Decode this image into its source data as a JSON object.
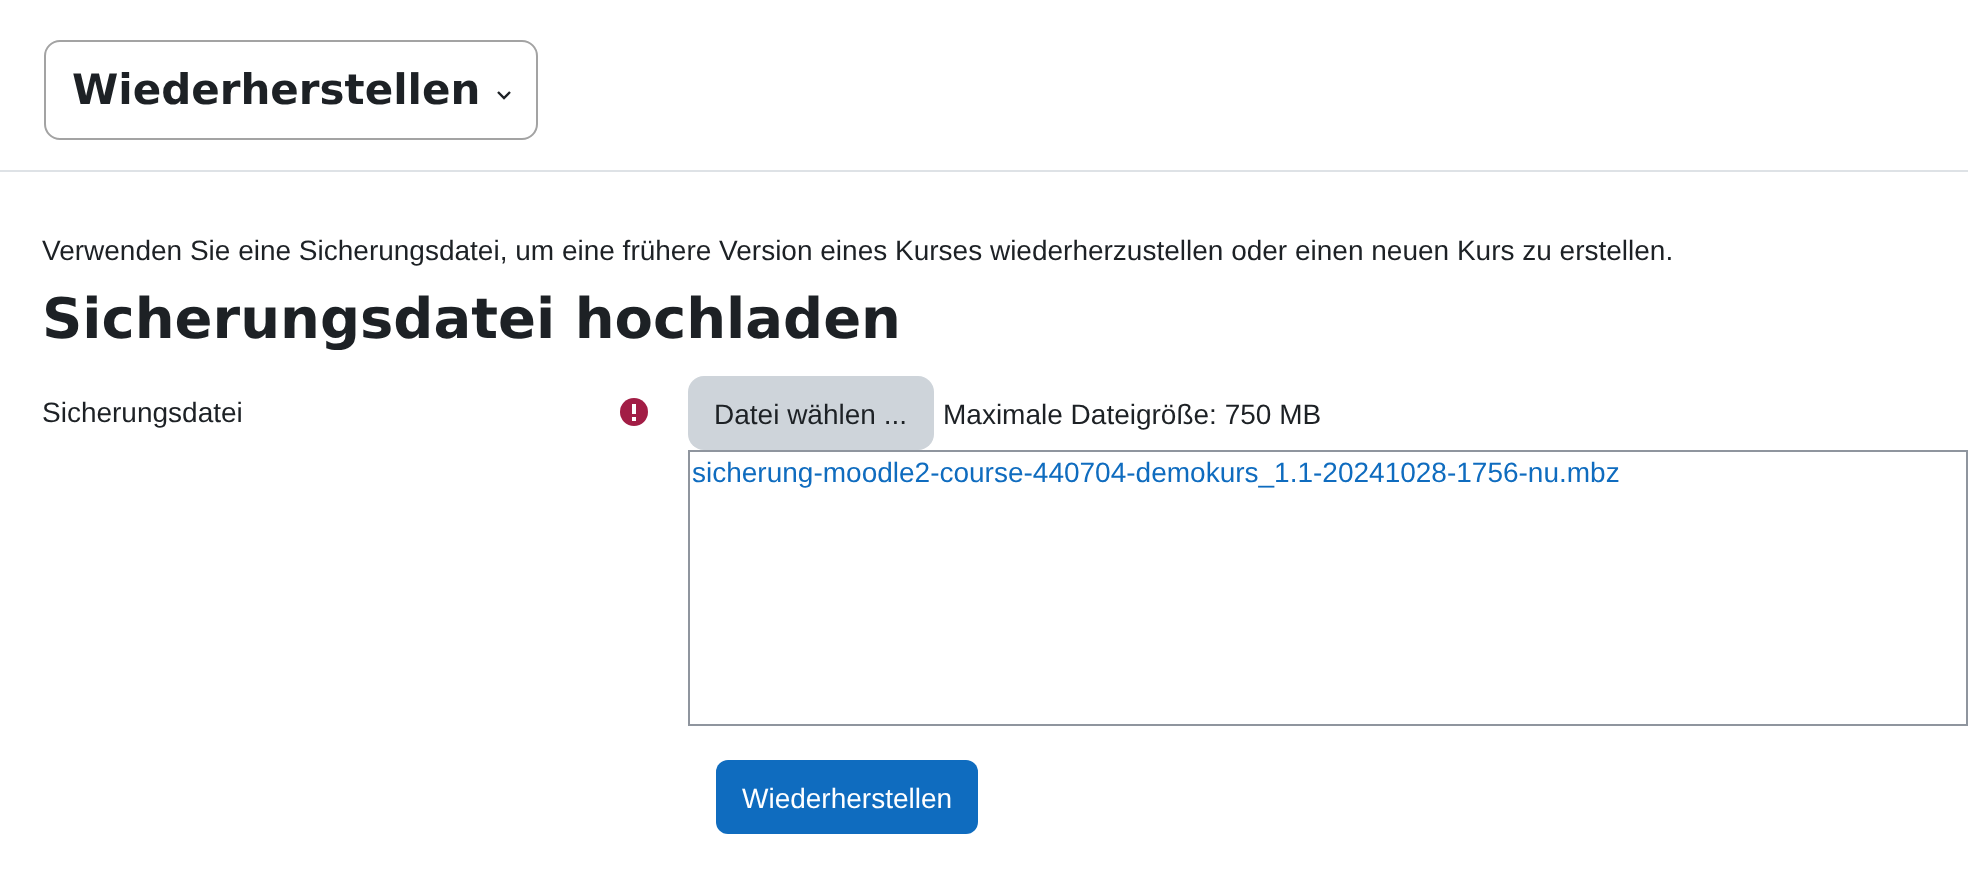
{
  "header": {
    "menu_label": "Wiederherstellen"
  },
  "intro": "Verwenden Sie eine Sicherungsdatei, um eine frühere Version eines Kurses wiederherzustellen oder einen neuen Kurs zu erstellen.",
  "section": {
    "title": "Sicherungsdatei hochladen"
  },
  "field": {
    "label": "Sicherungsdatei",
    "required": true,
    "choose_button": "Datei wählen ...",
    "max_size": "Maximale Dateigröße: 750 MB",
    "files": [
      "sicherung-moodle2-course-440704-demokurs_1.1-20241028-1756-nu.mbz"
    ]
  },
  "submit": "Wiederherstellen"
}
